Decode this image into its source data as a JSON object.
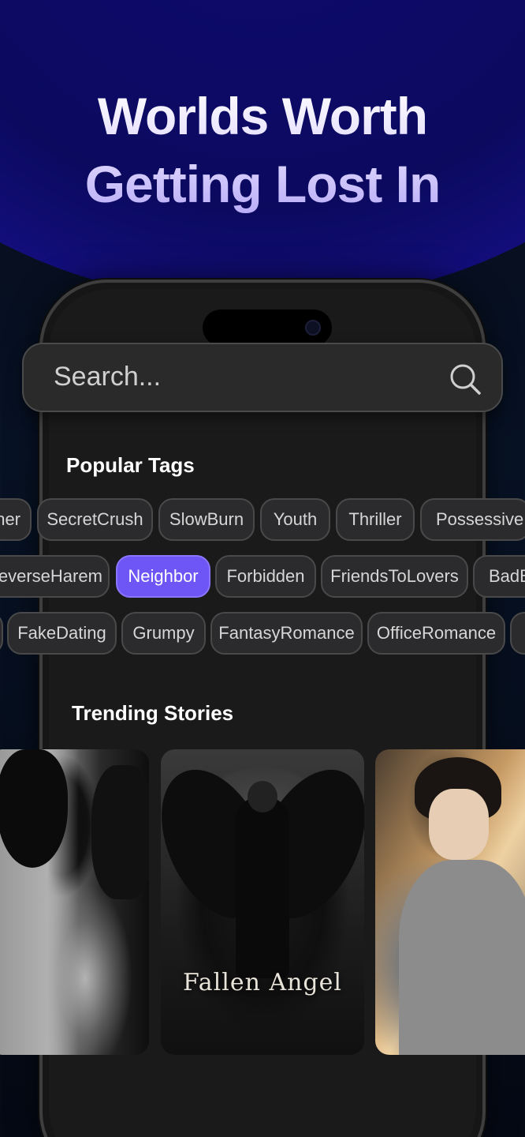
{
  "hero": {
    "line1": "Worlds Worth",
    "line2": "Getting Lost In"
  },
  "search": {
    "placeholder": "Search..."
  },
  "popular_tags": {
    "title": "Popular Tags",
    "rows": [
      [
        "ner",
        "SecretCrush",
        "SlowBurn",
        "Youth",
        "Thriller",
        "Possessive"
      ],
      [
        "ReverseHarem",
        "Neighbor",
        "Forbidden",
        "FriendsToLovers",
        "BadB"
      ],
      [
        "",
        "FakeDating",
        "Grumpy",
        "FantasyRomance",
        "OfficeRomance",
        ""
      ]
    ],
    "active": "Neighbor"
  },
  "trending": {
    "title": "Trending Stories",
    "stories": [
      {
        "title": ""
      },
      {
        "title": "Fallen Angel"
      },
      {
        "title": ""
      }
    ]
  },
  "colors": {
    "accent": "#6d55f6",
    "hero": "#0e0a6e"
  }
}
